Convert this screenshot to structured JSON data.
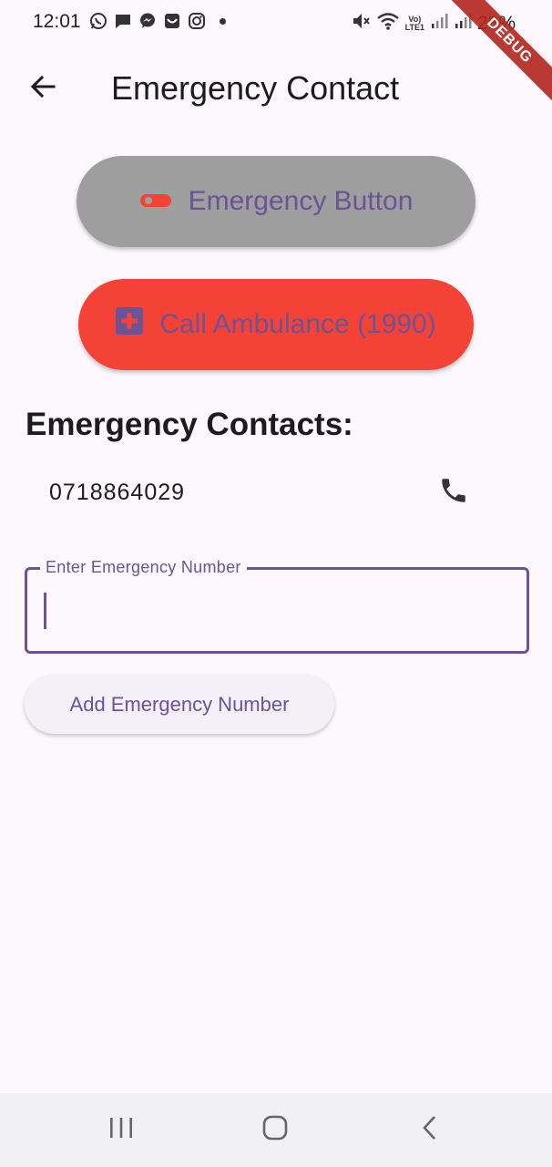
{
  "status_bar": {
    "time": "12:01",
    "battery": "28%",
    "network_label_top": "Vo)",
    "network_label_bottom": "LTE1",
    "left_icons": [
      "whatsapp-icon",
      "message-icon",
      "messenger-icon",
      "inbox-icon",
      "instagram-icon"
    ],
    "right_icons": [
      "mute-icon",
      "wifi-icon",
      "signal-icon",
      "signal-icon",
      "battery-icon"
    ]
  },
  "debug_banner": "DEBUG",
  "app_bar": {
    "title": "Emergency Contact",
    "back_icon": "arrow-back-icon"
  },
  "emergency_button": {
    "label": "Emergency Button",
    "icon": "toggle-icon",
    "background": "#9e9e9e"
  },
  "ambulance_button": {
    "label": "Call Ambulance (1990)",
    "icon": "medical-plus-icon",
    "background": "#f44336"
  },
  "contacts": {
    "heading": "Emergency Contacts:",
    "items": [
      {
        "number": "0718864029",
        "icon": "phone-icon"
      }
    ]
  },
  "input": {
    "label": "Enter Emergency Number",
    "value": ""
  },
  "add_button": {
    "label": "Add Emergency Number"
  },
  "colors": {
    "accent": "#6a5396",
    "background": "#fdf7fe",
    "danger": "#f44336"
  },
  "nav_bar": {
    "icons": [
      "recents-icon",
      "home-icon",
      "back-chevron-icon"
    ]
  }
}
